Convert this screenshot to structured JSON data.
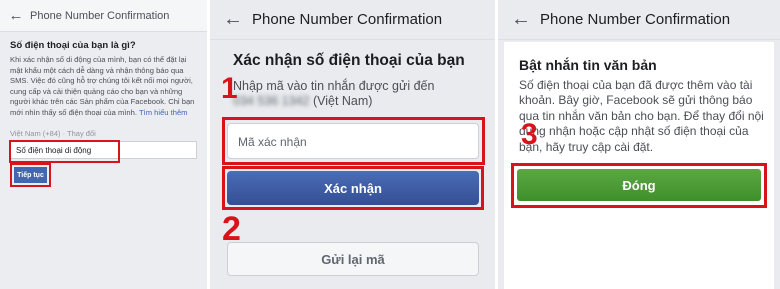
{
  "panel1": {
    "title": "Phone Number Confirmation",
    "back_icon": "arrow-left-icon",
    "heading": "Số điện thoại của bạn là gì?",
    "body": "Khi xác nhận số di động của mình, bạn có thể đặt lại mật khẩu một cách dễ dàng và nhận thông báo qua SMS. Việc đó cũng hỗ trợ chúng tôi kết nối mọi người, cung cấp và cải thiện quảng cáo cho bạn và những người khác trên các Sản phẩm của Facebook. Chỉ bạn mới nhìn thấy số điện thoại của mình.",
    "learn_more": "Tìm hiểu thêm",
    "country_line": "Việt Nam (+84) · Thay đổi",
    "phone_placeholder": "Số điện thoại di động",
    "next_button": "Tiếp tục"
  },
  "panel2": {
    "title": "Phone Number Confirmation",
    "back_icon": "arrow-left-icon",
    "heading": "Xác nhận số điện thoại của bạn",
    "instruction_prefix": "Nhập mã vào tin nhắn được gửi đến",
    "masked_number": "034 536 1342",
    "instruction_suffix": "(Việt Nam)",
    "code_placeholder": "Mã xác nhận",
    "confirm_button": "Xác nhận",
    "resend_button": "Gửi lại mã",
    "step1": "1",
    "step2": "2"
  },
  "panel3": {
    "title": "Phone Number Confirmation",
    "back_icon": "arrow-left-icon",
    "heading": "Bật nhắn tin văn bản",
    "body": "Số điện thoại của bạn đã được thêm vào tài khoản. Bây giờ, Facebook sẽ gửi thông báo qua tin nhắn văn bản cho bạn. Để thay đổi nội dung nhận hoặc cập nhật số điện thoại của bạn, hãy truy cập cài đặt.",
    "close_button": "Đóng",
    "step3": "3"
  },
  "colors": {
    "highlight": "#d7141a",
    "facebook_blue": "#4267b2",
    "confirm_green": "#4caf50"
  }
}
